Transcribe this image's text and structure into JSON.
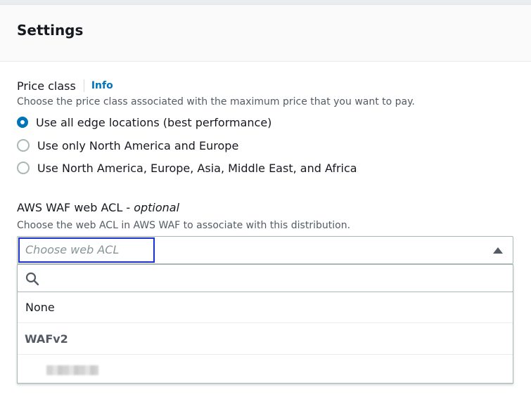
{
  "section": {
    "title": "Settings"
  },
  "price_class": {
    "label": "Price class",
    "info_link": "Info",
    "description": "Choose the price class associated with the maximum price that you want to pay.",
    "options": [
      {
        "label": "Use all edge locations (best performance)",
        "selected": true
      },
      {
        "label": "Use only North America and Europe",
        "selected": false
      },
      {
        "label": "Use North America, Europe, Asia, Middle East, and Africa",
        "selected": false
      }
    ]
  },
  "waf": {
    "label": "AWS WAF web ACL - ",
    "optional": "optional",
    "description": "Choose the web ACL in AWS WAF to associate with this distribution.",
    "select_placeholder": "Choose web ACL",
    "search_placeholder": "",
    "options": {
      "none": "None",
      "group": "WAFv2"
    }
  },
  "icons": {
    "search": "search-icon",
    "caret": "caret-up-icon"
  },
  "colors": {
    "accent": "#0073bb",
    "focus": "#1a2fd1",
    "text": "#16191f",
    "secondary_text": "#545b64"
  }
}
